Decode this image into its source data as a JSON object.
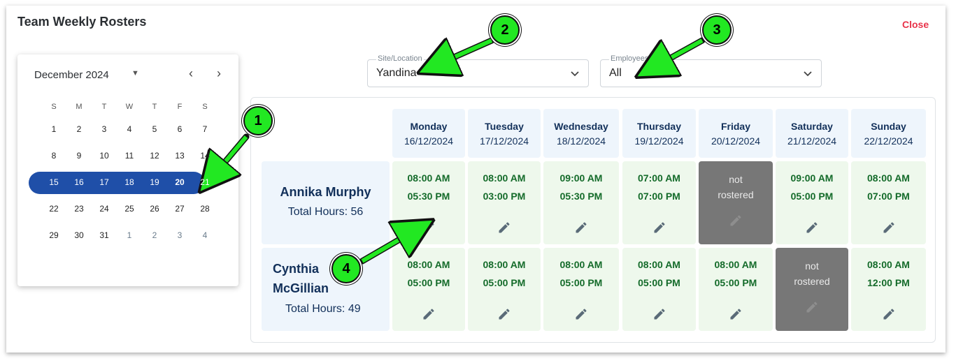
{
  "window": {
    "title": "Team Weekly Rosters",
    "close_label": "Close"
  },
  "calendar": {
    "month_label": "December 2024",
    "weekdays": [
      "S",
      "M",
      "T",
      "W",
      "T",
      "F",
      "S"
    ],
    "weeks": [
      [
        "1",
        "2",
        "3",
        "4",
        "5",
        "6",
        "7"
      ],
      [
        "8",
        "9",
        "10",
        "11",
        "12",
        "13",
        "14"
      ],
      [
        "15",
        "16",
        "17",
        "18",
        "19",
        "20",
        "21"
      ],
      [
        "22",
        "23",
        "24",
        "25",
        "26",
        "27",
        "28"
      ],
      [
        "29",
        "30",
        "31",
        "1",
        "2",
        "3",
        "4"
      ]
    ],
    "selected_week_index": 2
  },
  "filters": {
    "site": {
      "label": "Site/Location",
      "value": "Yandina"
    },
    "employees": {
      "label": "Employees",
      "value": "All"
    }
  },
  "days": [
    {
      "name": "Monday",
      "date": "16/12/2024"
    },
    {
      "name": "Tuesday",
      "date": "17/12/2024"
    },
    {
      "name": "Wednesday",
      "date": "18/12/2024"
    },
    {
      "name": "Thursday",
      "date": "19/12/2024"
    },
    {
      "name": "Friday",
      "date": "20/12/2024"
    },
    {
      "name": "Saturday",
      "date": "21/12/2024"
    },
    {
      "name": "Sunday",
      "date": "22/12/2024"
    }
  ],
  "employees": [
    {
      "name": "Annika Murphy",
      "total_hours": "Total Hours: 56",
      "shifts": [
        {
          "start": "08:00 AM",
          "end": "05:30 PM"
        },
        {
          "start": "08:00 AM",
          "end": "03:00 PM"
        },
        {
          "start": "09:00 AM",
          "end": "05:30 PM"
        },
        {
          "start": "07:00 AM",
          "end": "07:00 PM"
        },
        {
          "start": "not",
          "end": "rostered",
          "off": true
        },
        {
          "start": "09:00 AM",
          "end": "05:00 PM"
        },
        {
          "start": "08:00 AM",
          "end": "07:00 PM"
        }
      ]
    },
    {
      "name_line1": "Cynthia",
      "name_line2": "McGillian",
      "total_hours": "Total Hours: 49",
      "shifts": [
        {
          "start": "08:00 AM",
          "end": "05:00 PM"
        },
        {
          "start": "08:00 AM",
          "end": "05:00 PM"
        },
        {
          "start": "08:00 AM",
          "end": "05:00 PM"
        },
        {
          "start": "08:00 AM",
          "end": "05:00 PM"
        },
        {
          "start": "08:00 AM",
          "end": "05:00 PM"
        },
        {
          "start": "not",
          "end": "rostered",
          "off": true
        },
        {
          "start": "08:00 AM",
          "end": "12:00 PM"
        }
      ]
    }
  ],
  "annotations": [
    "1",
    "2",
    "3",
    "4"
  ],
  "colors": {
    "accent": "#1f4fa8",
    "annotation": "#22e822",
    "close": "#e8334a",
    "shift_bg": "#eef8ec",
    "off_bg": "#777777"
  }
}
